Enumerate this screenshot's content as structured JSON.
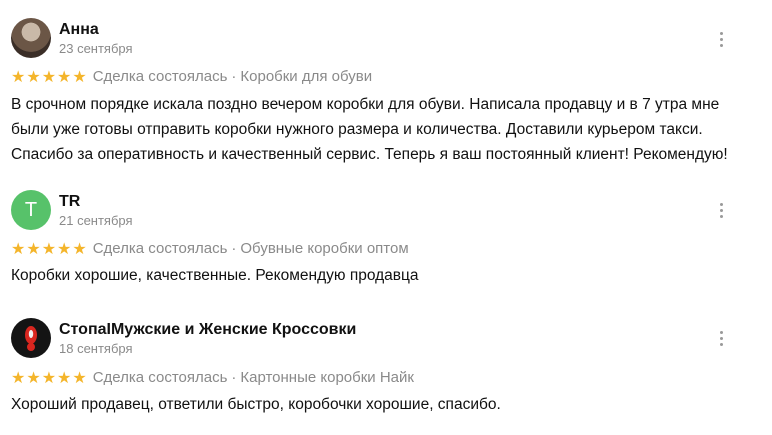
{
  "reviews": [
    {
      "author": "Анна",
      "date": "23 сентября",
      "avatar": {
        "type": "photo",
        "letter": ""
      },
      "rating": 5,
      "deal_status": "Сделка состоялась",
      "category": "Коробки для обуви",
      "text_lines": [
        "В срочном порядке искала поздно вечером коробки для обуви. Написала продавцу и в 7 утра мне",
        "были уже готовы отправить коробки нужного размера и количества. Доставили курьером такси.",
        "Спасибо за оперативность и качественный сервис. Теперь я ваш постоянный клиент! Рекомендую!"
      ]
    },
    {
      "author": "TR",
      "date": "21 сентября",
      "avatar": {
        "type": "letter",
        "letter": "T",
        "color": "#57c26a"
      },
      "rating": 5,
      "deal_status": "Сделка состоялась",
      "category": "Обувные коробки оптом",
      "text_lines": [
        "Коробки хорошие, качественные. Рекомендую продавца"
      ]
    },
    {
      "author": "СтопаIМужские и Женские Кроссовки",
      "date": "18 сентября",
      "avatar": {
        "type": "logo",
        "letter": ""
      },
      "rating": 5,
      "deal_status": "Сделка состоялась",
      "category": "Картонные коробки Найк",
      "text_lines": [
        "Хороший продавец, ответили быстро, коробочки хорошие, спасибо."
      ]
    }
  ],
  "ui": {
    "separator": "·",
    "star_icon": "star-icon",
    "more_icon": "more-vertical-icon",
    "star_color": "#f4b52b"
  }
}
